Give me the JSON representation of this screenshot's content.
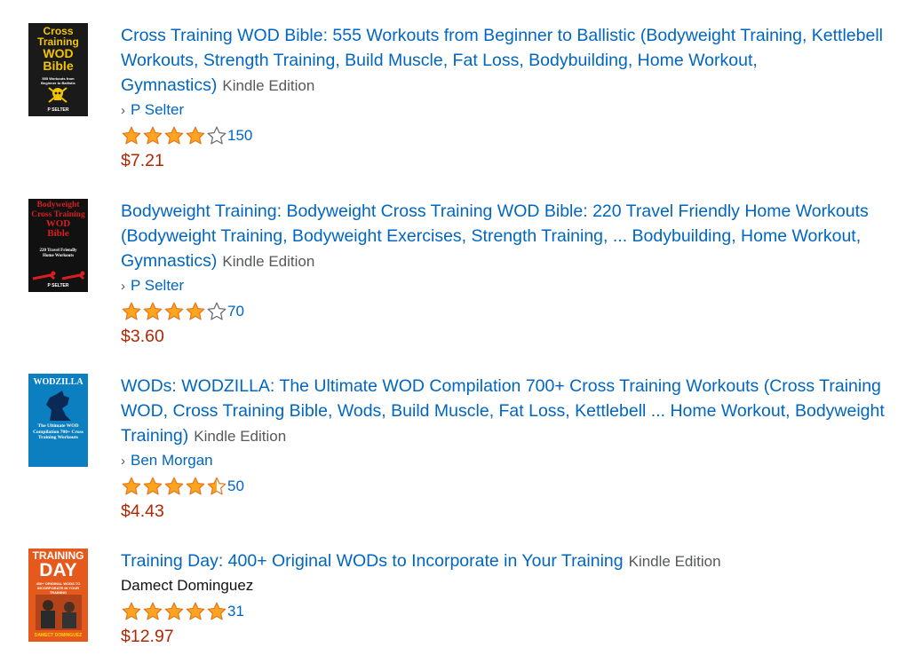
{
  "colors": {
    "link": "#0066c0",
    "price": "#b12704",
    "format": "#565959",
    "star_fill": "#ffa41c",
    "star_stroke": "#de7921"
  },
  "results": [
    {
      "title": "Cross Training WOD Bible: 555 Workouts from Beginner to Ballistic (Bodyweight Training, Kettlebell Workouts, Strength Training, Build Muscle, Fat Loss, Bodybuilding, Home Workout, Gymnastics)",
      "format": "Kindle Edition",
      "author": "P Selter",
      "author_is_link": true,
      "rating": 4.0,
      "review_count": "150",
      "price": "$7.21",
      "cover": {
        "title_lines": [
          "Cross",
          "Training",
          "WOD",
          "Bible"
        ],
        "subtitle": "555 Workouts from Beginner to Ballistic",
        "author": "P SELTER"
      }
    },
    {
      "title": "Bodyweight Training: Bodyweight Cross Training WOD Bible: 220 Travel Friendly Home Workouts (Bodyweight Training, Bodyweight Exercises, Strength Training, ... Bodybuilding, Home Workout, Gymnastics)",
      "format": "Kindle Edition",
      "author": "P Selter",
      "author_is_link": true,
      "rating": 4.0,
      "review_count": "70",
      "price": "$3.60",
      "cover": {
        "title_lines": [
          "Bodyweight",
          "Cross Training",
          "WOD",
          "Bible"
        ],
        "subtitle": "220 Travel Friendly Home Workouts",
        "author": "P SELTER"
      }
    },
    {
      "title": "WODs: WODZILLA: The Ultimate WOD Compilation 700+ Cross Training Workouts (Cross Training WOD, Cross Training Bible, Wods, Build Muscle, Fat Loss, Kettlebell ... Home Workout, Bodyweight Training)",
      "format": "Kindle Edition",
      "author": "Ben Morgan",
      "author_is_link": true,
      "rating": 4.5,
      "review_count": "50",
      "price": "$4.43",
      "cover": {
        "title_lines": [
          "WODZILLA"
        ],
        "subtitle": "The Ultimate WOD Compilation 700+ Cross Training Workouts",
        "author": ""
      }
    },
    {
      "title": "Training Day: 400+ Original WODs to Incorporate in Your Training",
      "format": "Kindle Edition",
      "author": "Damect Dominguez",
      "author_is_link": false,
      "rating": 5.0,
      "review_count": "31",
      "price": "$12.97",
      "cover": {
        "title_lines": [
          "TRAINING",
          "DAY"
        ],
        "subtitle": "400+ ORIGINAL WODS TO INCORPORATE IN YOUR TRAINING",
        "author": "DAMECT DOMINGUEZ"
      }
    }
  ]
}
